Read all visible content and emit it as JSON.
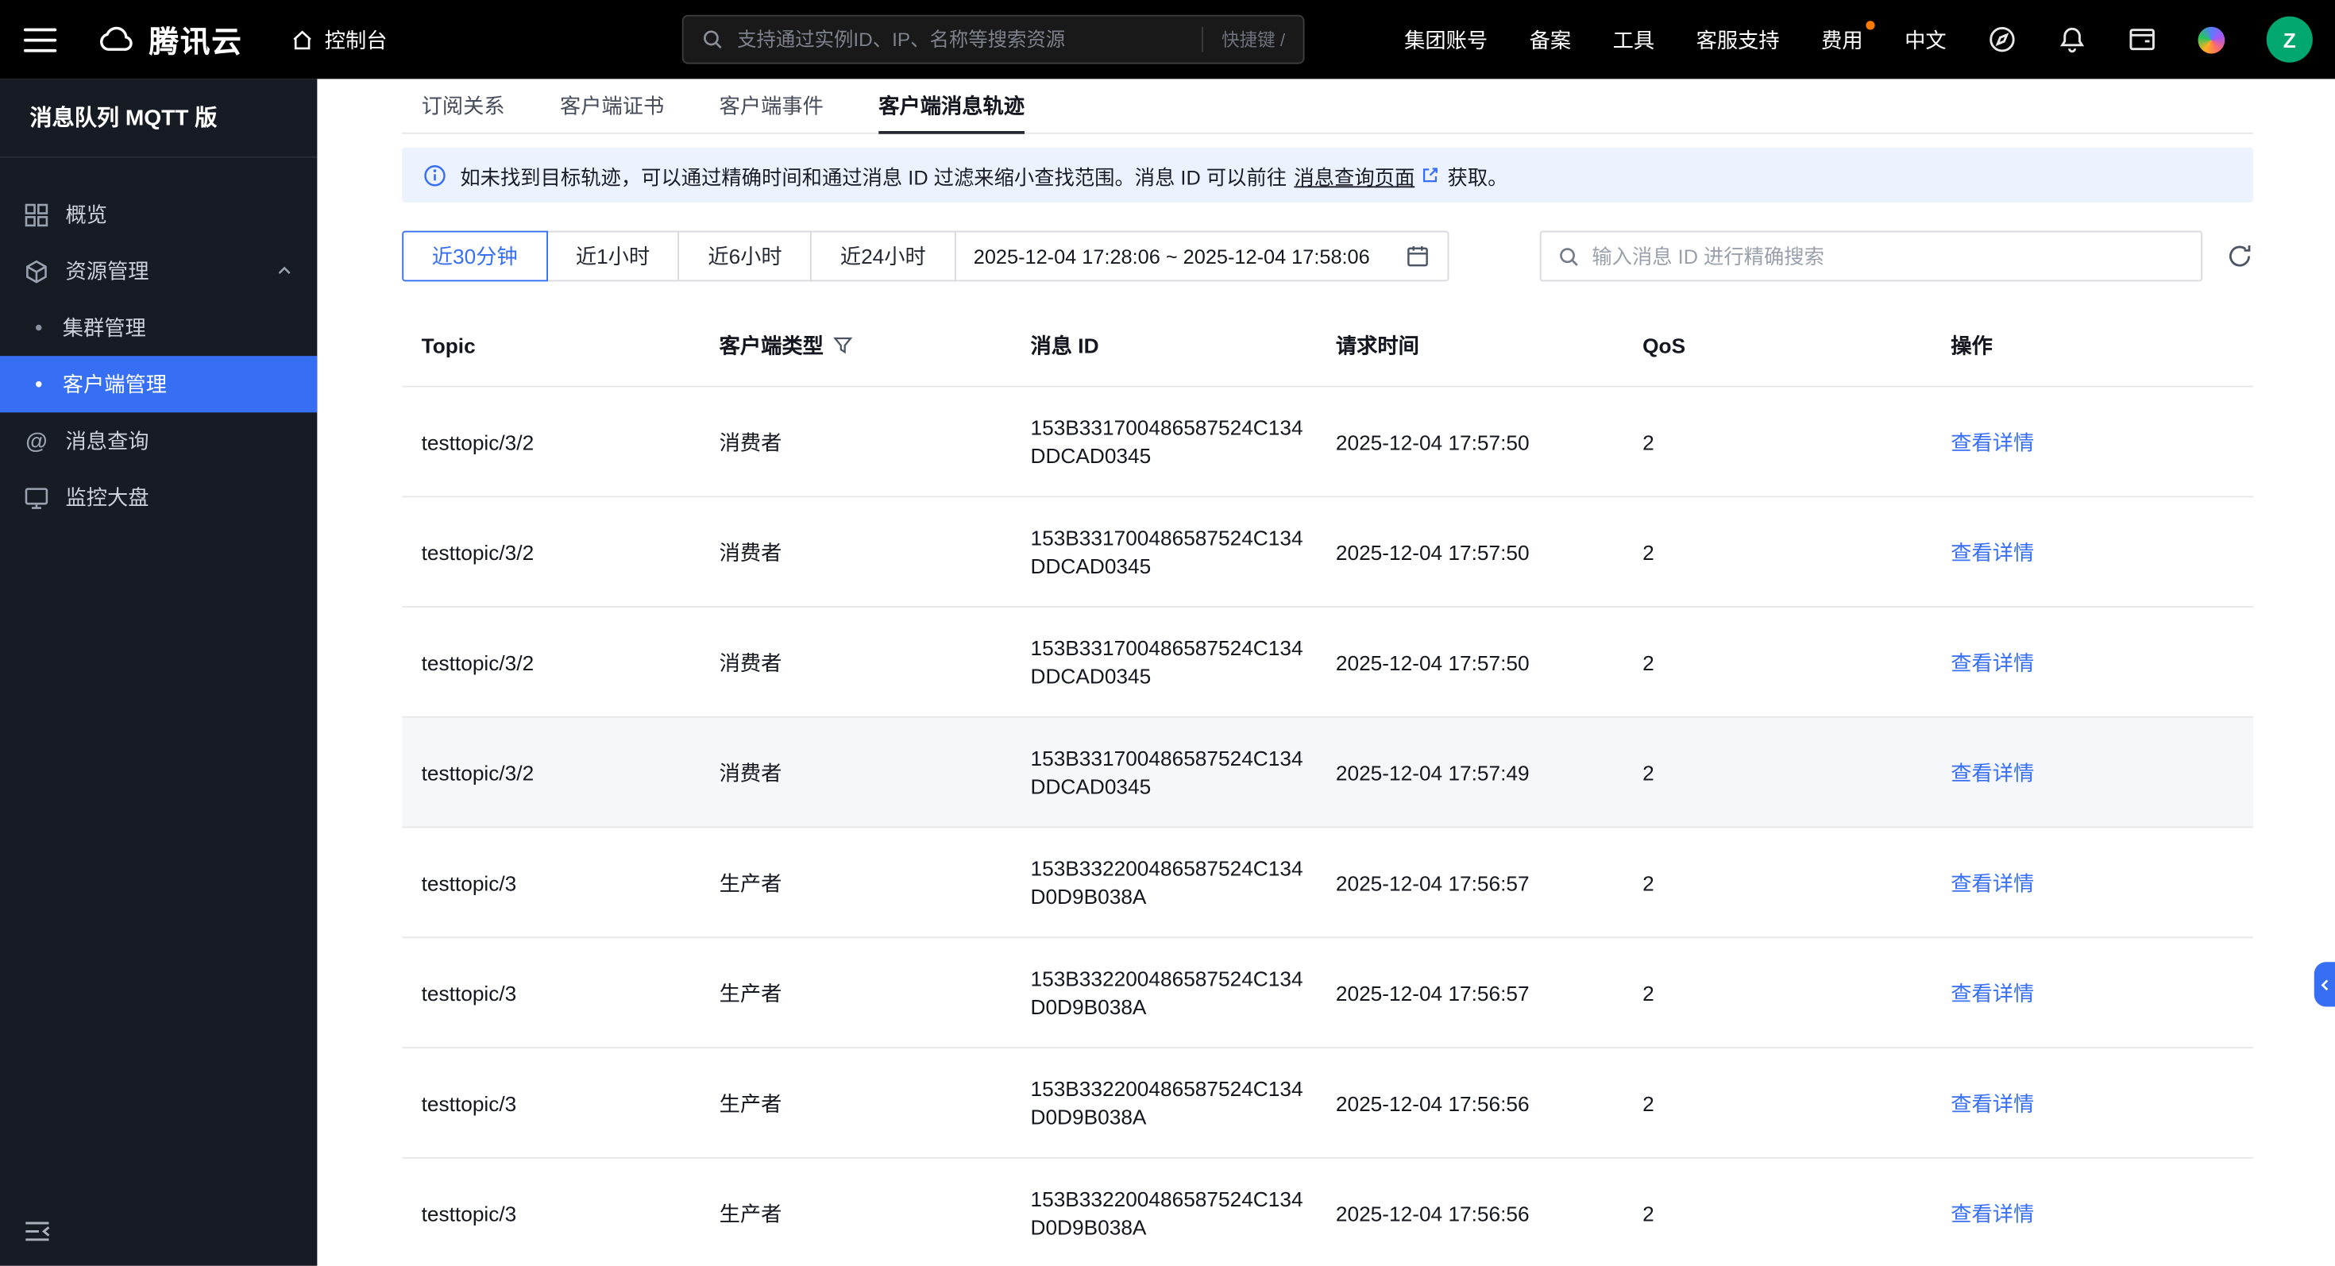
{
  "topbar": {
    "logo_text": "腾讯云",
    "console_label": "控制台",
    "search_placeholder": "支持通过实例ID、IP、名称等搜索资源",
    "shortcut_hint": "快捷键 /",
    "group_account": "集团账号",
    "icp_filing": "备案",
    "tools": "工具",
    "support": "客服支持",
    "billing": "费用",
    "language": "中文",
    "avatar_initial": "Z"
  },
  "sidebar": {
    "title": "消息队列 MQTT 版",
    "items": [
      {
        "label": "概览"
      },
      {
        "label": "资源管理"
      },
      {
        "label": "集群管理"
      },
      {
        "label": "客户端管理"
      },
      {
        "label": "消息查询"
      },
      {
        "label": "监控大盘"
      }
    ]
  },
  "tabs": [
    "订阅关系",
    "客户端证书",
    "客户端事件",
    "客户端消息轨迹"
  ],
  "banner": {
    "text_before": "如未找到目标轨迹，可以通过精确时间和通过消息 ID 过滤来缩小查找范围。消息 ID 可以前往",
    "link_text": "消息查询页面",
    "text_after": "获取。"
  },
  "filters": {
    "quick_ranges": [
      "近30分钟",
      "近1小时",
      "近6小时",
      "近24小时"
    ],
    "active_range": "近30分钟",
    "date_range": "2025-12-04 17:28:06 ~ 2025-12-04 17:58:06",
    "search_placeholder": "输入消息 ID 进行精确搜索"
  },
  "table": {
    "columns": [
      "Topic",
      "客户端类型",
      "消息 ID",
      "请求时间",
      "QoS",
      "操作"
    ],
    "action_label": "查看详情",
    "rows": [
      {
        "topic": "testtopic/3/2",
        "client_type": "消费者",
        "message_id": "153B331700486587524C134DDCAD0345",
        "request_time": "2025-12-04 17:57:50",
        "qos": "2"
      },
      {
        "topic": "testtopic/3/2",
        "client_type": "消费者",
        "message_id": "153B331700486587524C134DDCAD0345",
        "request_time": "2025-12-04 17:57:50",
        "qos": "2"
      },
      {
        "topic": "testtopic/3/2",
        "client_type": "消费者",
        "message_id": "153B331700486587524C134DDCAD0345",
        "request_time": "2025-12-04 17:57:50",
        "qos": "2"
      },
      {
        "topic": "testtopic/3/2",
        "client_type": "消费者",
        "message_id": "153B331700486587524C134DDCAD0345",
        "request_time": "2025-12-04 17:57:49",
        "qos": "2"
      },
      {
        "topic": "testtopic/3",
        "client_type": "生产者",
        "message_id": "153B332200486587524C134D0D9B038A",
        "request_time": "2025-12-04 17:56:57",
        "qos": "2"
      },
      {
        "topic": "testtopic/3",
        "client_type": "生产者",
        "message_id": "153B332200486587524C134D0D9B038A",
        "request_time": "2025-12-04 17:56:57",
        "qos": "2"
      },
      {
        "topic": "testtopic/3",
        "client_type": "生产者",
        "message_id": "153B332200486587524C134D0D9B038A",
        "request_time": "2025-12-04 17:56:56",
        "qos": "2"
      },
      {
        "topic": "testtopic/3",
        "client_type": "生产者",
        "message_id": "153B332200486587524C134D0D9B038A",
        "request_time": "2025-12-04 17:56:56",
        "qos": "2"
      }
    ]
  },
  "colors": {
    "accent": "#366ef4",
    "topbar_bg": "#000000",
    "sidebar_bg": "#171b24",
    "banner_bg": "#ecf2fe",
    "billing_dot": "#ff7a00",
    "avatar_bg": "#00a870"
  }
}
